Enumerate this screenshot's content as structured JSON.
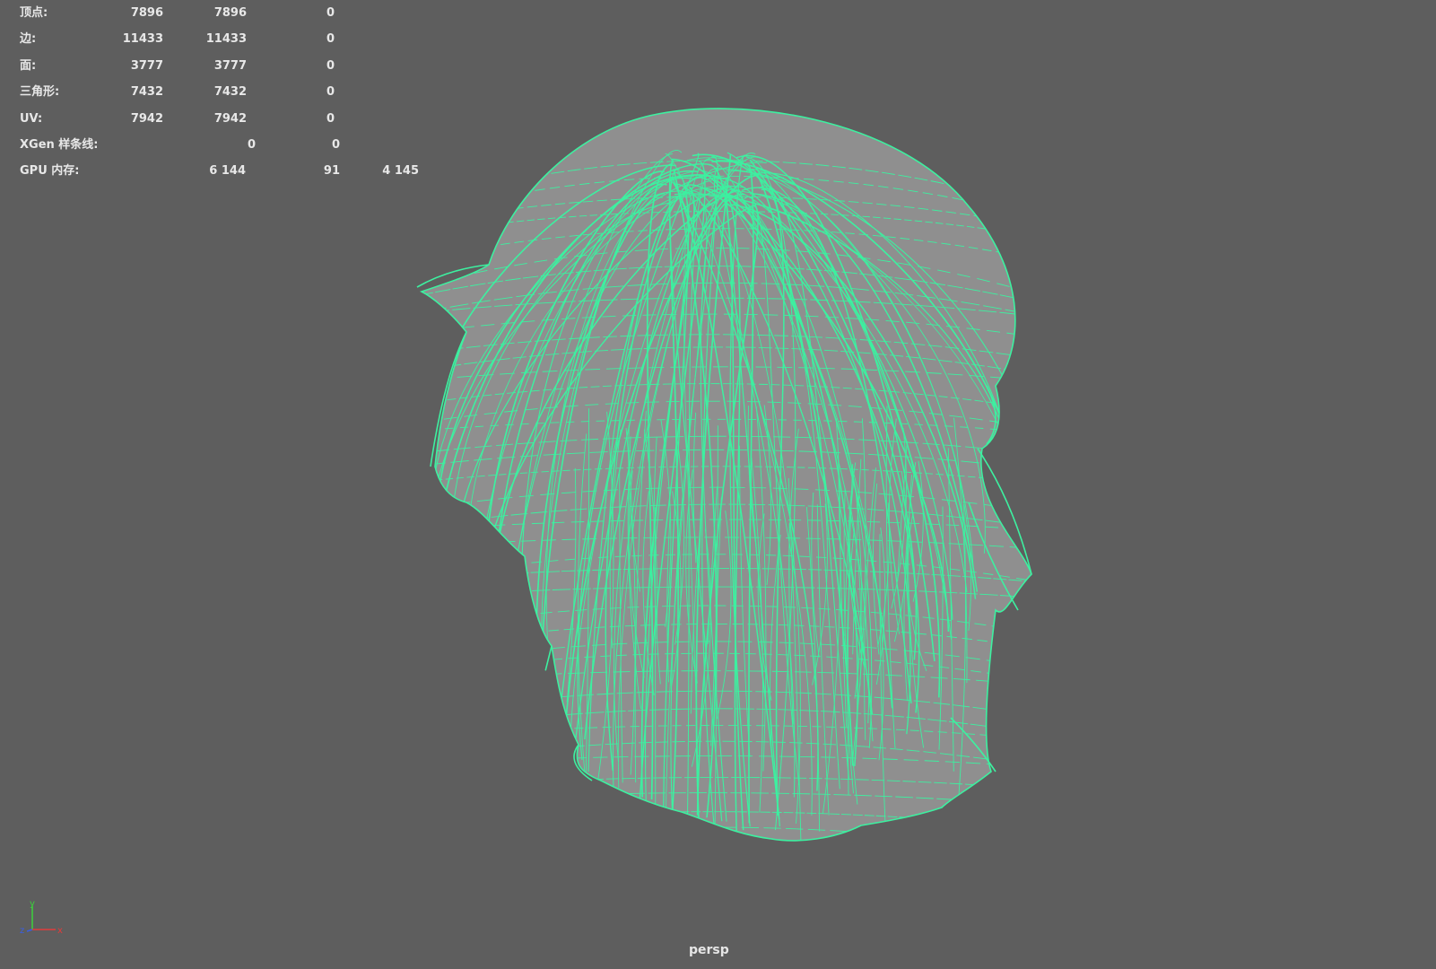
{
  "hud": {
    "rows": [
      {
        "label": "顶点:",
        "v1": "7896",
        "v2": "7896",
        "v3": "0"
      },
      {
        "label": "边:",
        "v1": "11433",
        "v2": "11433",
        "v3": "0"
      },
      {
        "label": "面:",
        "v1": "3777",
        "v2": "3777",
        "v3": "0"
      },
      {
        "label": "三角形:",
        "v1": "7432",
        "v2": "7432",
        "v3": "0"
      },
      {
        "label": "UV:",
        "v1": "7942",
        "v2": "7942",
        "v3": "0"
      }
    ],
    "xgen": {
      "label": "XGen 样条线:",
      "v1": "0",
      "v2": "0"
    },
    "gpu": {
      "label": "GPU 内存:",
      "v1": "6 144",
      "v2": "91",
      "v3": "4 145"
    }
  },
  "viewport": {
    "camera": "persp",
    "background": "#5e5e5e",
    "wire_color": "#3df0a0",
    "surface_color": "#8f8f8f"
  },
  "axis": {
    "x": "x",
    "y": "y",
    "z": "z",
    "x_color": "#e23b3b",
    "y_color": "#3bd13b",
    "z_color": "#3b5fe2"
  }
}
